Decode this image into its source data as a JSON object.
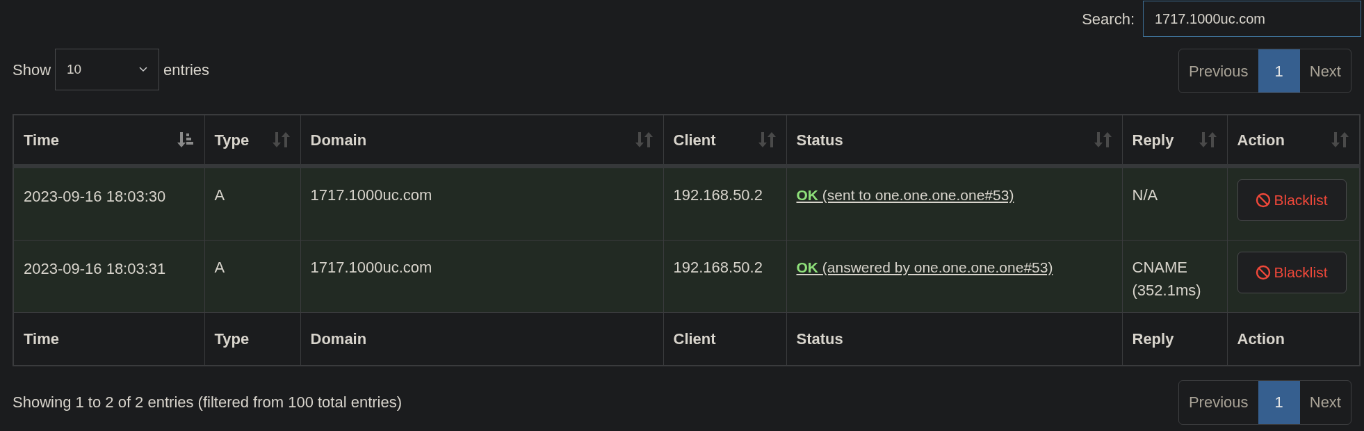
{
  "search": {
    "label": "Search:",
    "value": "1717.1000uc.com"
  },
  "length": {
    "before": "Show",
    "value": "10",
    "after": "entries"
  },
  "pagination_top": [
    {
      "label": "Previous",
      "selected": false
    },
    {
      "label": "1",
      "selected": true
    },
    {
      "label": "Next",
      "selected": false
    }
  ],
  "table": {
    "columns": [
      {
        "label": "Time",
        "sorted": true
      },
      {
        "label": "Type",
        "sorted": false
      },
      {
        "label": "Domain",
        "sorted": false
      },
      {
        "label": "Client",
        "sorted": false
      },
      {
        "label": "Status",
        "sorted": false
      },
      {
        "label": "Reply",
        "sorted": false
      },
      {
        "label": "Action",
        "sorted": false
      }
    ],
    "rows": [
      {
        "time": "2023-09-16 18:03:30",
        "type": "A",
        "domain": "1717.1000uc.com",
        "client": "192.168.50.2",
        "status": {
          "label": "OK",
          "detail": "(sent to one.one.one.one#53)"
        },
        "reply": "N/A",
        "action": "Blacklist"
      },
      {
        "time": "2023-09-16 18:03:31",
        "type": "A",
        "domain": "1717.1000uc.com",
        "client": "192.168.50.2",
        "status": {
          "label": "OK",
          "detail": "(answered by one.one.one.one#53)"
        },
        "reply": "CNAME (352.1ms)",
        "action": "Blacklist"
      }
    ],
    "footer": [
      "Time",
      "Type",
      "Domain",
      "Client",
      "Status",
      "Reply",
      "Action"
    ]
  },
  "info": "Showing 1 to 2 of 2 entries (filtered from 100 total entries)",
  "pagination_bottom": [
    {
      "label": "Previous",
      "selected": false
    },
    {
      "label": "1",
      "selected": true
    },
    {
      "label": "Next",
      "selected": false
    }
  ]
}
